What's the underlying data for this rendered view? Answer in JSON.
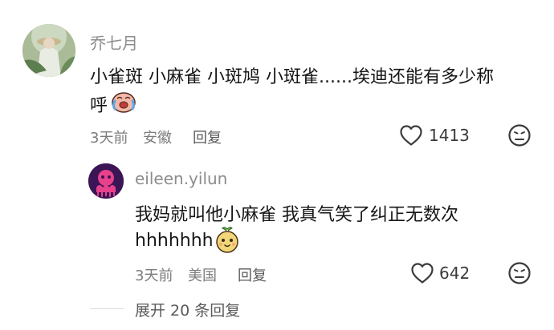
{
  "comments": [
    {
      "username": "乔七月",
      "text_line1": "小雀斑 小麻雀 小斑鸠 小斑雀......埃迪还能有多少称",
      "text_line2": "呼",
      "emoji": "crying-laughing-emoji",
      "time": "3天前",
      "location": "安徽",
      "reply_label": "回复",
      "likes": "1413"
    },
    {
      "username": "eileen.yilun",
      "text_line1": "我妈就叫他小麻雀 我真气笑了纠正无数次",
      "text_line2": "hhhhhhh",
      "emoji": "potato-emoji",
      "time": "3天前",
      "location": "美国",
      "reply_label": "回复",
      "likes": "642"
    }
  ],
  "expand_replies": "展开 20 条回复",
  "colors": {
    "text": "#161616",
    "secondary": "#8c8c8c",
    "icon": "#3a3a3a",
    "avatar_reply_bg": "#3b1556",
    "avatar_reply_accent": "#e8418c"
  }
}
